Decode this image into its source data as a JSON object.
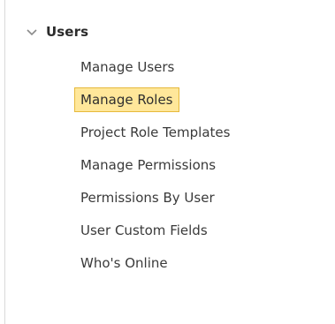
{
  "section": {
    "title": "Users",
    "expanded": true,
    "icon": "chevron-down-icon",
    "icon_color": "#8a8a8a"
  },
  "nav": {
    "items": [
      {
        "label": "Manage Users",
        "selected": false
      },
      {
        "label": "Manage Roles",
        "selected": true
      },
      {
        "label": "Project Role Templates",
        "selected": false
      },
      {
        "label": "Manage Permissions",
        "selected": false
      },
      {
        "label": "Permissions By User",
        "selected": false
      },
      {
        "label": "User Custom Fields",
        "selected": false
      },
      {
        "label": "Who's Online",
        "selected": false
      }
    ]
  },
  "colors": {
    "selected_bg": "#ffe79a",
    "selected_border": "#e6b93c",
    "text": "#3a3a3a",
    "divider": "#d9d9d9"
  }
}
